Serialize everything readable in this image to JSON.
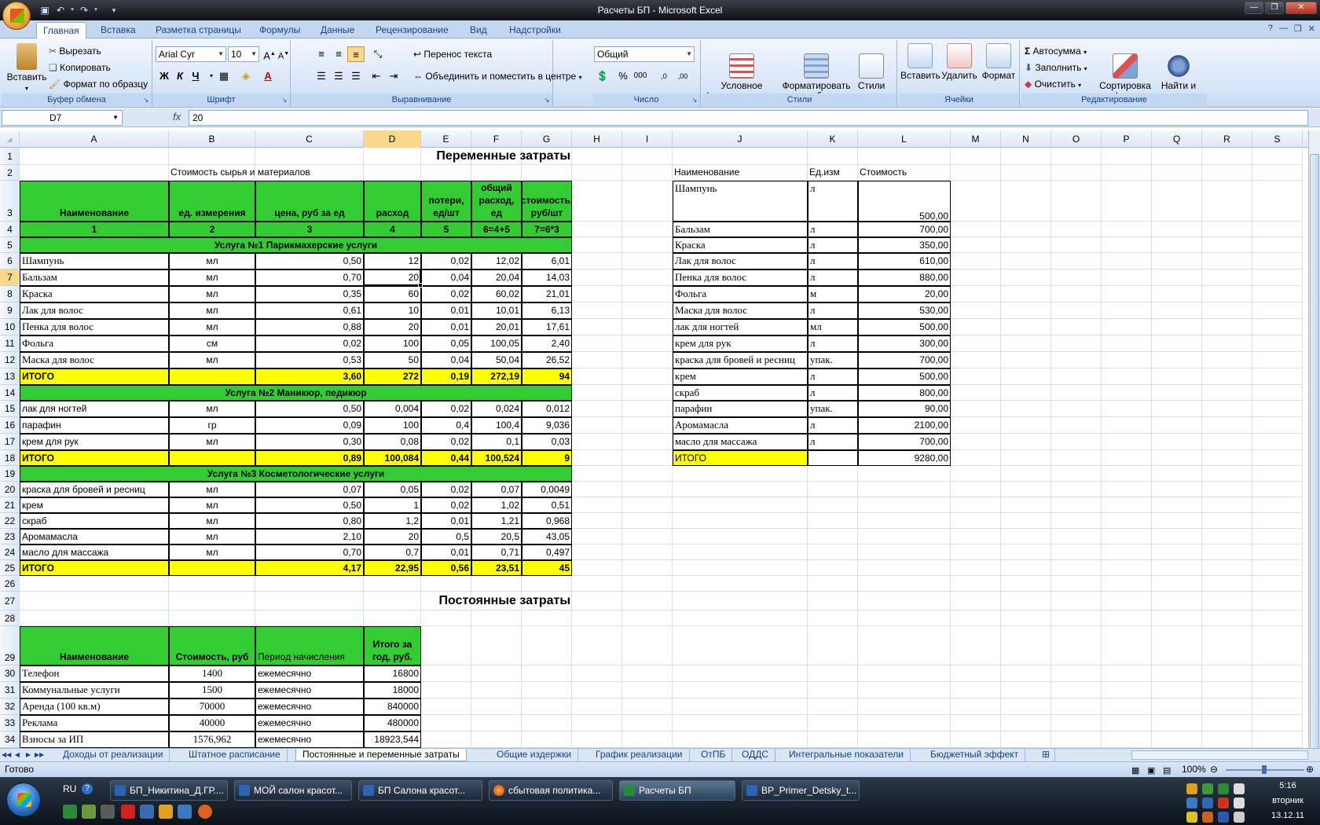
{
  "window": {
    "title": "Расчеты БП - Microsoft Excel"
  },
  "ribbon_tabs": [
    "Главная",
    "Вставка",
    "Разметка страницы",
    "Формулы",
    "Данные",
    "Рецензирование",
    "Вид",
    "Надстройки"
  ],
  "clipboard": {
    "paste": "Вставить",
    "cut": "Вырезать",
    "copy": "Копировать",
    "format_painter": "Формат по образцу",
    "label": "Буфер обмена"
  },
  "font": {
    "name": "Arial Cyr",
    "size": "10",
    "bold": "Ж",
    "italic": "К",
    "underline": "Ч",
    "label": "Шрифт"
  },
  "alignment": {
    "wrap": "Перенос текста",
    "merge": "Объединить и поместить в центре",
    "label": "Выравнивание"
  },
  "number": {
    "format": "Общий",
    "label": "Число"
  },
  "styles": {
    "conditional": "Условное\nформатирование",
    "as_table": "Форматировать\nкак таблицу",
    "cell_styles": "Стили\nячеек",
    "label": "Стили"
  },
  "cells": {
    "insert": "Вставить",
    "delete": "Удалить",
    "format": "Формат",
    "label": "Ячейки"
  },
  "editing": {
    "autosum": "Автосумма",
    "fill": "Заполнить",
    "clear": "Очистить",
    "sort": "Сортировка\nи фильтр",
    "find": "Найти и\nвыделить",
    "label": "Редактирование"
  },
  "formula_bar": {
    "name_box": "D7",
    "fx": "fx",
    "value": "20"
  },
  "columns": [
    "A",
    "B",
    "C",
    "D",
    "E",
    "F",
    "G",
    "H",
    "I",
    "J",
    "K",
    "L",
    "M",
    "N",
    "O",
    "P",
    "Q",
    "R",
    "S"
  ],
  "rows": [
    "1",
    "2",
    "3",
    "4",
    "5",
    "6",
    "7",
    "8",
    "9",
    "10",
    "11",
    "12",
    "13",
    "14",
    "15",
    "16",
    "17",
    "18",
    "19",
    "20",
    "21",
    "22",
    "23",
    "24",
    "25",
    "26",
    "27",
    "28",
    "29",
    "30",
    "31",
    "32",
    "33",
    "34"
  ],
  "sheet": {
    "title_var": "Переменные затраты",
    "subtitle": "Стоимость сырья и материалов",
    "headers": [
      "Наименование",
      "ед. измерения",
      "цена, руб за ед",
      "расход",
      "потери, ед/шт",
      "общий расход, ед",
      "стоимость, руб/шт"
    ],
    "header_nums": [
      "1",
      "2",
      "3",
      "4",
      "5",
      "6=4+5",
      "7=6*3"
    ],
    "sections": [
      {
        "title": "Услуга №1 Парикмахерские услуги",
        "items": [
          [
            "Шампунь",
            "мл",
            "0,50",
            "12",
            "0,02",
            "12,02",
            "6,01"
          ],
          [
            "Бальзам",
            "мл",
            "0,70",
            "20",
            "0,04",
            "20,04",
            "14,03"
          ],
          [
            "Краска",
            "мл",
            "0,35",
            "60",
            "0,02",
            "60,02",
            "21,01"
          ],
          [
            "Лак для волос",
            "мл",
            "0,61",
            "10",
            "0,01",
            "10,01",
            "6,13"
          ],
          [
            "Пенка для волос",
            "мл",
            "0,88",
            "20",
            "0,01",
            "20,01",
            "17,61"
          ],
          [
            "Фольга",
            "см",
            "0,02",
            "100",
            "0,05",
            "100,05",
            "2,40"
          ],
          [
            "Маска для волос",
            "мл",
            "0,53",
            "50",
            "0,04",
            "50,04",
            "26,52"
          ]
        ],
        "total": [
          "ИТОГО",
          "",
          "3,60",
          "272",
          "0,19",
          "272,19",
          "94"
        ]
      },
      {
        "title": "Услуга №2 Маникюр, педикюр",
        "items": [
          [
            "лак для ногтей",
            "мл",
            "0,50",
            "0,004",
            "0,02",
            "0,024",
            "0,012"
          ],
          [
            "парафин",
            "гр",
            "0,09",
            "100",
            "0,4",
            "100,4",
            "9,036"
          ],
          [
            "крем для рук",
            "мл",
            "0,30",
            "0,08",
            "0,02",
            "0,1",
            "0,03"
          ]
        ],
        "total": [
          "ИТОГО",
          "",
          "0,89",
          "100,084",
          "0,44",
          "100,524",
          "9"
        ]
      },
      {
        "title": "Услуга №3 Косметологические услуги",
        "items": [
          [
            "краска для бровей и ресниц",
            "мл",
            "0,07",
            "0,05",
            "0,02",
            "0,07",
            "0,0049"
          ],
          [
            "крем",
            "мл",
            "0,50",
            "1",
            "0,02",
            "1,02",
            "0,51"
          ],
          [
            "скраб",
            "мл",
            "0,80",
            "1,2",
            "0,01",
            "1,21",
            "0,968"
          ],
          [
            "Аромамасла",
            "мл",
            "2,10",
            "20",
            "0,5",
            "20,5",
            "43,05"
          ],
          [
            "масло для массажа",
            "мл",
            "0,70",
            "0,7",
            "0,01",
            "0,71",
            "0,497"
          ]
        ],
        "total": [
          "ИТОГО",
          "",
          "4,17",
          "22,95",
          "0,56",
          "23,51",
          "45"
        ]
      }
    ],
    "title_fixed": "Постоянные затраты",
    "fixed_headers": [
      "Наименование",
      "Стоимость, руб",
      "Период начисления",
      "Итого за год, руб."
    ],
    "fixed_rows": [
      [
        "Телефон",
        "1400",
        "ежемесячно",
        "16800"
      ],
      [
        "Коммунальные услуги",
        "1500",
        "ежемесячно",
        "18000"
      ],
      [
        "Аренда (100 кв.м)",
        "70000",
        "ежемесячно",
        "840000"
      ],
      [
        "Реклама",
        "40000",
        "ежемесячно",
        "480000"
      ],
      [
        "Взносы за ИП",
        "1576,962",
        "ежемесячно",
        "18923,544"
      ]
    ],
    "price_headers": [
      "Наименование",
      "Ед.изм",
      "Стоимость"
    ],
    "price_rows": [
      [
        "Шампунь",
        "л",
        "500,00"
      ],
      [
        "Бальзам",
        "л",
        "700,00"
      ],
      [
        "Краска",
        "л",
        "350,00"
      ],
      [
        "Лак для волос",
        "л",
        "610,00"
      ],
      [
        "Пенка для волос",
        "л",
        "880,00"
      ],
      [
        "Фольга",
        "м",
        "20,00"
      ],
      [
        "Маска для волос",
        "л",
        "530,00"
      ],
      [
        "лак для ногтей",
        "мл",
        "500,00"
      ],
      [
        "крем для рук",
        "л",
        "300,00"
      ],
      [
        "краска для бровей и ресниц",
        "упак.",
        "700,00"
      ],
      [
        "крем",
        "л",
        "500,00"
      ],
      [
        "скраб",
        "л",
        "800,00"
      ],
      [
        "парафин",
        "упак.",
        "90,00"
      ],
      [
        "Аромамасла",
        "л",
        "2100,00"
      ],
      [
        "масло для массажа",
        "л",
        "700,00"
      ]
    ],
    "price_total": [
      "ИТОГО",
      "",
      "9280,00"
    ]
  },
  "sheet_tabs": [
    "Доходы от реализации",
    "Штатное расписание",
    "Постоянные и переменные затраты",
    "Общие издержки",
    "График реализации",
    "ОтПБ",
    "ОДДС",
    "Интегральные показатели",
    "Бюджетный эффект"
  ],
  "status": {
    "ready": "Готово",
    "zoom": "100%"
  },
  "taskbar": {
    "lang": "RU",
    "items": [
      "БП_Никитина_Д.ГР....",
      "МОЙ салон красот...",
      "БП Салона красот...",
      "сбытовая политика...",
      "Расчеты БП",
      "BP_Primer_Detsky_t..."
    ],
    "time": "5:16",
    "day": "вторник",
    "date": "13.12.11"
  }
}
